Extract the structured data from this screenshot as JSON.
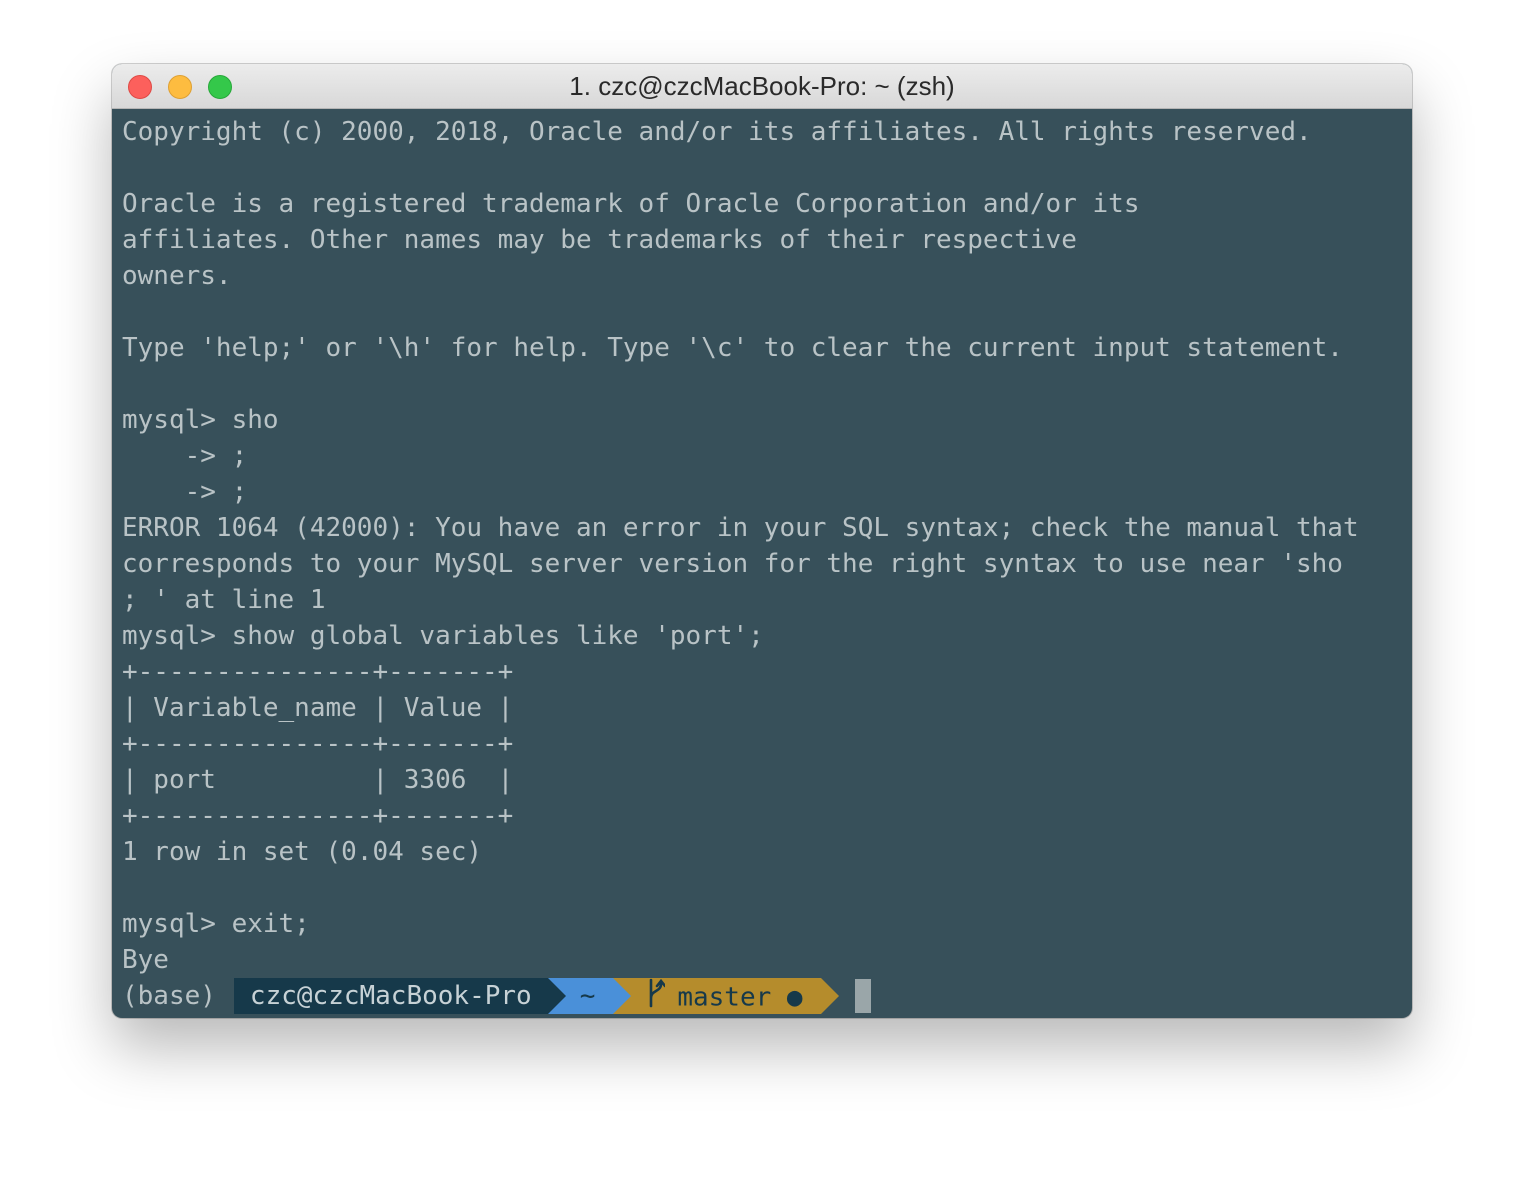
{
  "window": {
    "title": "1. czc@czcMacBook-Pro: ~ (zsh)"
  },
  "terminal": {
    "lines": [
      "Copyright (c) 2000, 2018, Oracle and/or its affiliates. All rights reserved.",
      "",
      "Oracle is a registered trademark of Oracle Corporation and/or its",
      "affiliates. Other names may be trademarks of their respective",
      "owners.",
      "",
      "Type 'help;' or '\\h' for help. Type '\\c' to clear the current input statement.",
      "",
      "mysql> sho",
      "    -> ;",
      "    -> ;",
      "ERROR 1064 (42000): You have an error in your SQL syntax; check the manual that",
      "corresponds to your MySQL server version for the right syntax to use near 'sho",
      "; ' at line 1",
      "mysql> show global variables like 'port';",
      "+---------------+-------+",
      "| Variable_name | Value |",
      "+---------------+-------+",
      "| port          | 3306  |",
      "+---------------+-------+",
      "1 row in set (0.04 sec)",
      "",
      "mysql> exit;",
      "Bye"
    ],
    "prompt": {
      "env": "(base)",
      "user_host": "czc@czcMacBook-Pro",
      "dir": "~",
      "branch": "master",
      "status_dot": "●"
    }
  },
  "colors": {
    "background": "#37505a",
    "text": "#b9c3c6",
    "user_segment": "#16394a",
    "dir_segment": "#4a90d9",
    "git_segment": "#b58c2c"
  }
}
